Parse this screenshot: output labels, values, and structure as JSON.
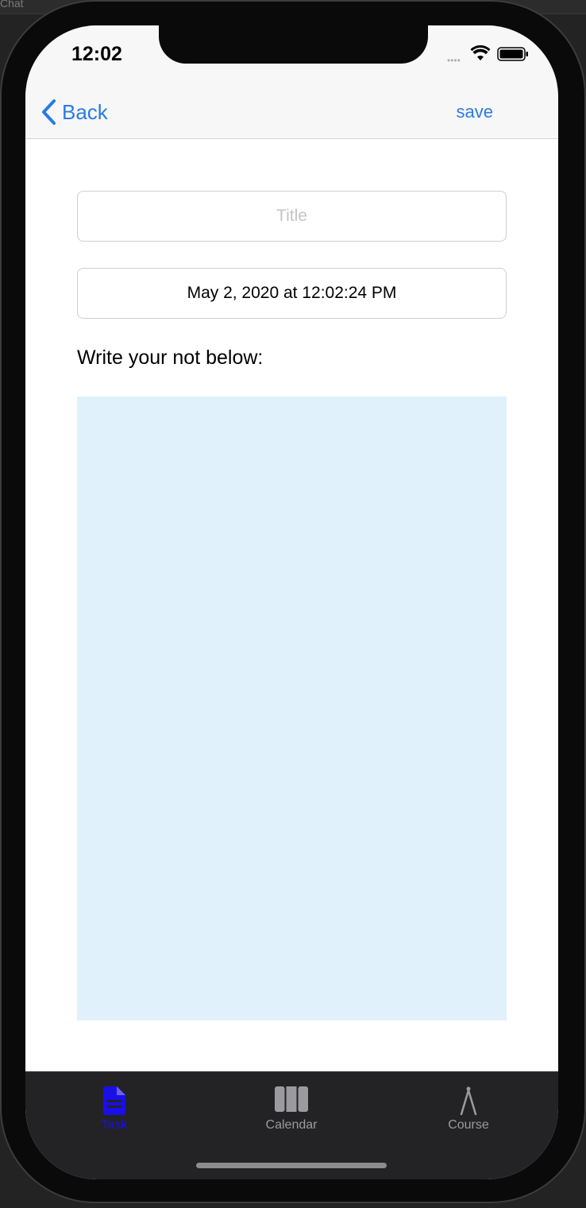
{
  "simulator": {
    "top_label": "Chat"
  },
  "status_bar": {
    "time": "12:02",
    "cell_signal": "••••"
  },
  "nav": {
    "back_label": "Back",
    "save_label": "save"
  },
  "form": {
    "title_placeholder": "Title",
    "date_value": "May 2, 2020 at 12:02:24 PM",
    "note_label": "Write your not below:",
    "note_value": ""
  },
  "tabs": [
    {
      "label": "Task",
      "icon": "document-icon",
      "selected": true
    },
    {
      "label": "Calendar",
      "icon": "columns-icon",
      "selected": false
    },
    {
      "label": "Course",
      "icon": "compass-icon",
      "selected": false
    }
  ],
  "colors": {
    "accent": "#2a7be4",
    "selected_tab": "#1a0fe6",
    "unselected_tab": "#9b9b9f",
    "note_background": "#e0f1fb",
    "tab_bar_background": "#232325"
  }
}
